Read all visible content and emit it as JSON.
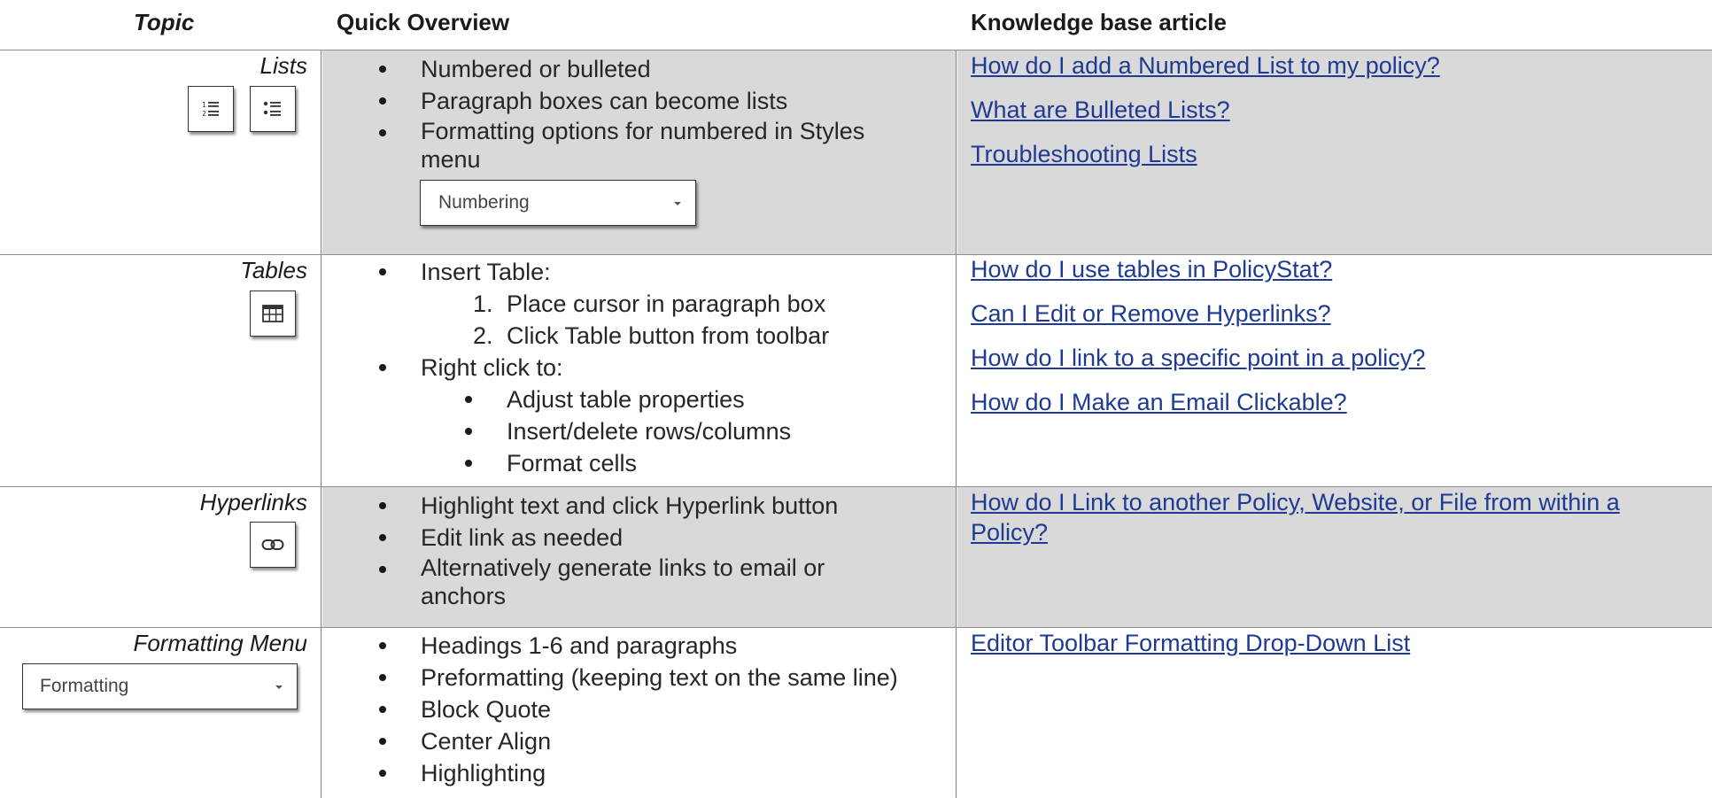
{
  "headers": {
    "topic": "Topic",
    "quick": "Quick Overview",
    "kb": "Knowledge base article"
  },
  "rows": {
    "lists": {
      "topic": "Lists",
      "icons": [
        "numbered-list-icon",
        "bulleted-list-icon"
      ],
      "bullets": [
        "Numbered or bulleted",
        "Paragraph boxes can become lists",
        "Formatting options for numbered in Styles menu"
      ],
      "dropdown": "Numbering",
      "links": [
        "How do I add a Numbered List to my policy?",
        "What are Bulleted Lists?",
        "Troubleshooting Lists"
      ]
    },
    "tables": {
      "topic": "Tables",
      "icons": [
        "table-icon"
      ],
      "insert": "Insert Table:",
      "steps": [
        "Place cursor in paragraph box",
        "Click Table button from toolbar"
      ],
      "step_numbers": [
        "1.",
        "2."
      ],
      "right_click": "Right click to:",
      "sub_bullets": [
        "Adjust table properties",
        "Insert/delete rows/columns",
        "Format cells"
      ],
      "links": [
        "How do I use tables in PolicyStat?",
        "Can I Edit or Remove Hyperlinks?",
        "How do I link to a specific point in a policy?",
        "How do I Make an Email Clickable?"
      ]
    },
    "hyperlinks": {
      "topic": "Hyperlinks",
      "icons": [
        "link-icon"
      ],
      "bullets": [
        "Highlight text and click Hyperlink button",
        "Edit link as needed",
        "Alternatively generate links to email or anchors"
      ],
      "links": [
        "How do I Link to another Policy, Website, or File from within a Policy?"
      ]
    },
    "formatting": {
      "topic": "Formatting Menu",
      "dropdown": "Formatting",
      "bullets": [
        "Headings 1-6 and paragraphs",
        "Preformatting (keeping text on the same line)",
        "Block Quote",
        "Center Align",
        "Highlighting"
      ],
      "links": [
        "Editor Toolbar Formatting Drop-Down List"
      ]
    }
  }
}
